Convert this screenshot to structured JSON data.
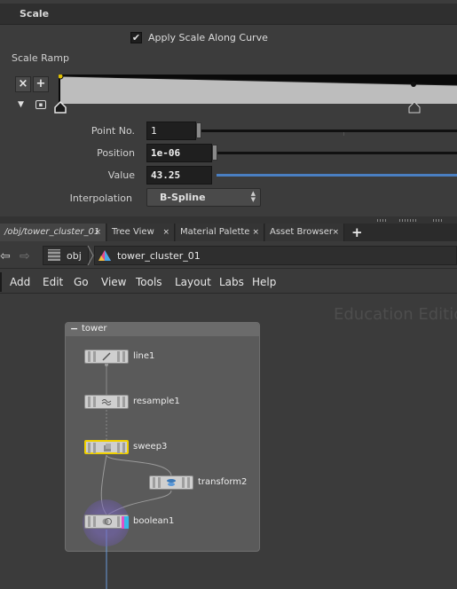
{
  "params": {
    "section_title": "Scale",
    "apply_scale_label": "Apply Scale Along Curve",
    "apply_scale_checked": true,
    "ramp_label": "Scale Ramp",
    "ramp_clear": "×",
    "ramp_add": "+",
    "point_no_label": "Point No.",
    "point_no_value": "1",
    "position_label": "Position",
    "position_value": "1e-06",
    "value_label": "Value",
    "value_value": "43.25",
    "interpolation_label": "Interpolation",
    "interpolation_value": "B-Spline"
  },
  "tabs": [
    {
      "label": "/obj/tower_cluster_01",
      "close": "×"
    },
    {
      "label": "Tree View",
      "close": "×"
    },
    {
      "label": "Material Palette",
      "close": "×"
    },
    {
      "label": "Asset Browser",
      "close": "×"
    }
  ],
  "tab_add": "+",
  "pathbar": {
    "back": "⇦",
    "forward": "⇨",
    "root": "obj",
    "node": "tower_cluster_01"
  },
  "menu": [
    "Add",
    "Edit",
    "Go",
    "View",
    "Tools",
    "Layout",
    "Labs",
    "Help"
  ],
  "network": {
    "watermark": "Education Edition",
    "box_title": "tower",
    "box_collapse": "−",
    "nodes": {
      "line1": "line1",
      "resample1": "resample1",
      "sweep3": "sweep3",
      "transform2": "transform2",
      "boolean1": "boolean1"
    }
  },
  "colors": {
    "selected_node_outline": "#f0d000",
    "value_slider": "#4a7fc2",
    "boolean_flag_pink": "#e050c8",
    "boolean_flag_blue": "#35b8e8"
  }
}
